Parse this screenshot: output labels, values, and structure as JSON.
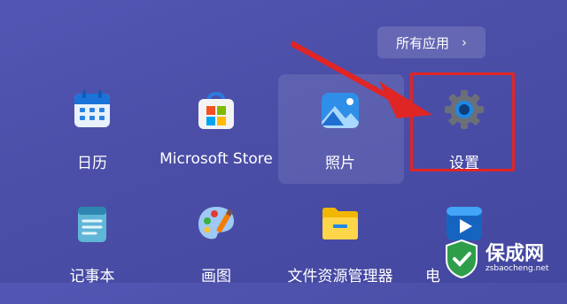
{
  "all_apps": {
    "label": "所有应用",
    "chevron": "›"
  },
  "apps_row1": [
    {
      "label": "日历",
      "icon": "calendar-icon"
    },
    {
      "label": "Microsoft Store",
      "icon": "store-icon"
    },
    {
      "label": "照片",
      "icon": "photos-icon"
    },
    {
      "label": "设置",
      "icon": "gear-icon"
    }
  ],
  "apps_row2": [
    {
      "label": "记事本",
      "icon": "notepad-icon"
    },
    {
      "label": "画图",
      "icon": "paint-icon"
    },
    {
      "label": "文件资源管理器",
      "icon": "folder-icon"
    },
    {
      "label": "电",
      "icon": "media-player-icon"
    }
  ],
  "watermark": {
    "text": "保成网",
    "url": "zsbaocheng.net"
  },
  "colors": {
    "annotation_red": "#e02525",
    "background": "#4b4ea6"
  }
}
